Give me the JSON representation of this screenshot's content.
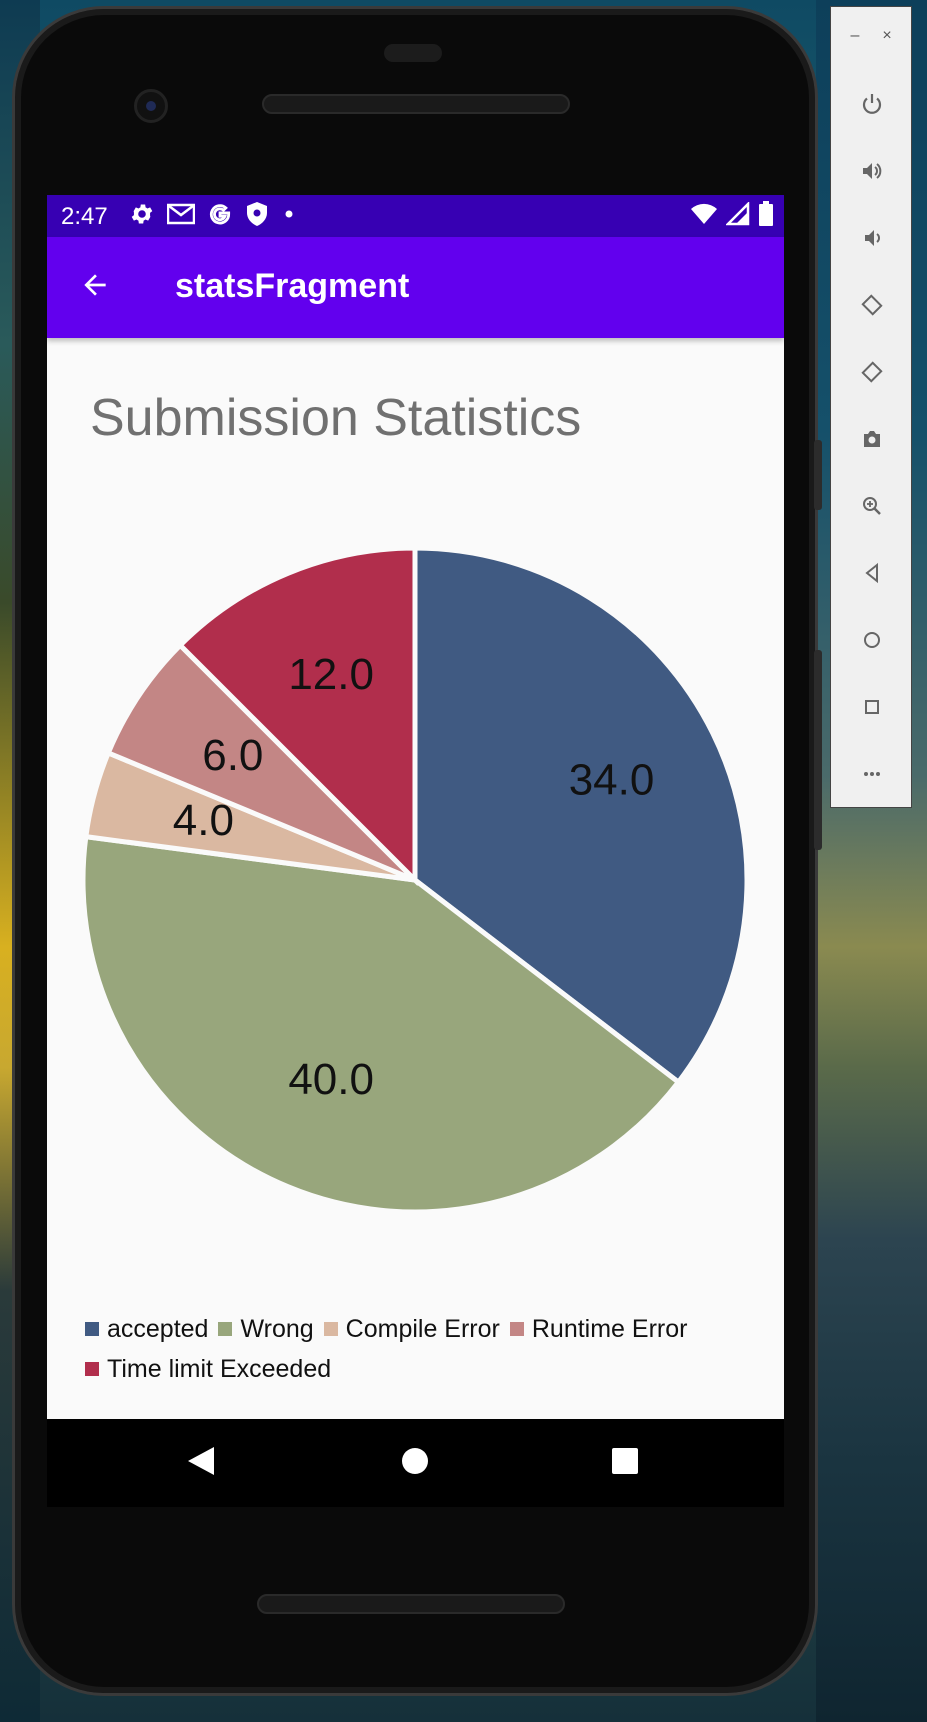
{
  "status_bar": {
    "time": "2:47",
    "left_icons": [
      "gear-icon",
      "gmail-icon",
      "google-g-icon",
      "shield-icon",
      "dot-icon"
    ],
    "right_icons": [
      "wifi-icon",
      "cellular-signal-icon",
      "battery-icon"
    ]
  },
  "app_bar": {
    "title": "statsFragment",
    "back_icon": "arrow-back-icon"
  },
  "content": {
    "title": "Submission Statistics"
  },
  "chart_data": {
    "type": "pie",
    "title": "",
    "slices": [
      {
        "label": "accepted",
        "value": 34.0,
        "value_text": "34.0",
        "color": "#405a82"
      },
      {
        "label": "Wrong",
        "value": 40.0,
        "value_text": "40.0",
        "color": "#98a67c"
      },
      {
        "label": "Compile Error",
        "value": 4.0,
        "value_text": "4.0",
        "color": "#dab8a1"
      },
      {
        "label": "Runtime Error",
        "value": 6.0,
        "value_text": "6.0",
        "color": "#c38685"
      },
      {
        "label": "Time limit Exceeded",
        "value": 12.0,
        "value_text": "12.0",
        "color": "#b12e4c"
      }
    ],
    "start_angle_deg": 0,
    "direction": "clockwise",
    "legend_position": "bottom-left"
  },
  "nav_bar": {
    "back": "triangle-back-icon",
    "home": "circle-home-icon",
    "recents": "square-recents-icon"
  },
  "emulator_panel": {
    "window_controls": {
      "minimize": "–",
      "close": "×"
    },
    "buttons": [
      "power-icon",
      "volume-up-icon",
      "volume-down-icon",
      "rotate-left-icon",
      "rotate-right-icon",
      "camera-icon",
      "zoom-icon",
      "back-icon",
      "home-icon",
      "overview-icon",
      "more-icon"
    ]
  },
  "colors": {
    "status_bar": "#3700b3",
    "app_bar": "#6200ee",
    "screen_background": "#fafafa",
    "title_text": "#707070"
  }
}
